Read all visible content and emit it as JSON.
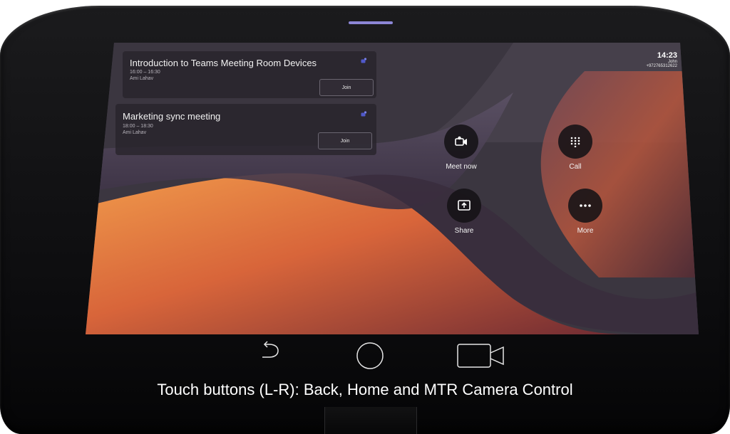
{
  "device": {
    "accent": "#8c86d6"
  },
  "status": {
    "time": "14:23",
    "user": "John",
    "phone": "+972765312622"
  },
  "meetings": [
    {
      "title": "Introduction to Teams Meeting Room Devices",
      "time": "16:00 – 16:30",
      "organizer": "Ami Lahav",
      "join_label": "Join"
    },
    {
      "title": "Marketing sync meeting",
      "time": "18:00 – 18:30",
      "organizer": "Ami Lahav",
      "join_label": "Join"
    }
  ],
  "actions": {
    "meet_now": {
      "label": "Meet now",
      "icon": "video-camera-icon"
    },
    "call": {
      "label": "Call",
      "icon": "dialpad-icon"
    },
    "share": {
      "label": "Share",
      "icon": "share-screen-icon"
    },
    "more": {
      "label": "More",
      "icon": "more-dots-icon"
    }
  },
  "touch_buttons": {
    "back": "back-arrow-icon",
    "home": "home-circle-icon",
    "camera": "camera-control-icon"
  },
  "caption": "Touch buttons (L-R): Back, Home and MTR Camera Control"
}
